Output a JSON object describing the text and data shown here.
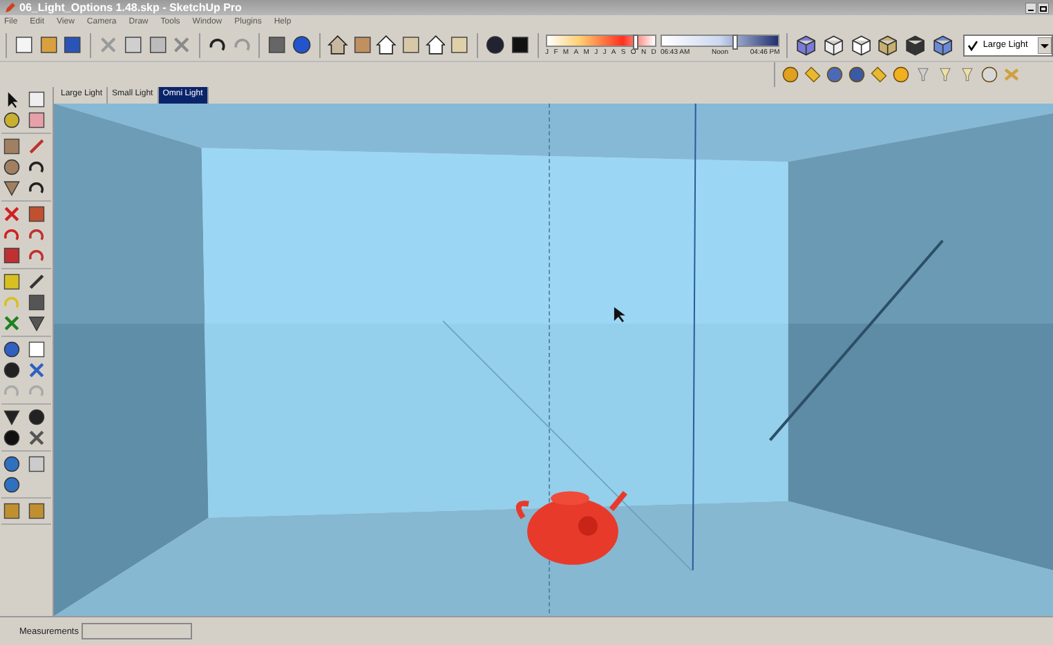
{
  "window": {
    "title": "06_Light_Options 1.48.skp - SketchUp Pro"
  },
  "menu": [
    "File",
    "Edit",
    "View",
    "Camera",
    "Draw",
    "Tools",
    "Window",
    "Plugins",
    "Help"
  ],
  "shadow_settings": {
    "months": [
      "J",
      "F",
      "M",
      "A",
      "M",
      "J",
      "J",
      "A",
      "S",
      "O",
      "N",
      "D"
    ],
    "date_slider": {
      "level": 0.8
    },
    "time_labels": [
      "06:43 AM",
      "Noon",
      "04:46 PM"
    ],
    "time_slider": {
      "level": 0.6
    }
  },
  "scene_dropdown": {
    "checked": true,
    "label": "Large Light"
  },
  "tabs": [
    {
      "label": "Large Light",
      "selected": false
    },
    {
      "label": "Small Light",
      "selected": false
    },
    {
      "label": "Omni Light",
      "selected": true
    }
  ],
  "status_bar": {
    "measurements_label": "Measurements"
  }
}
